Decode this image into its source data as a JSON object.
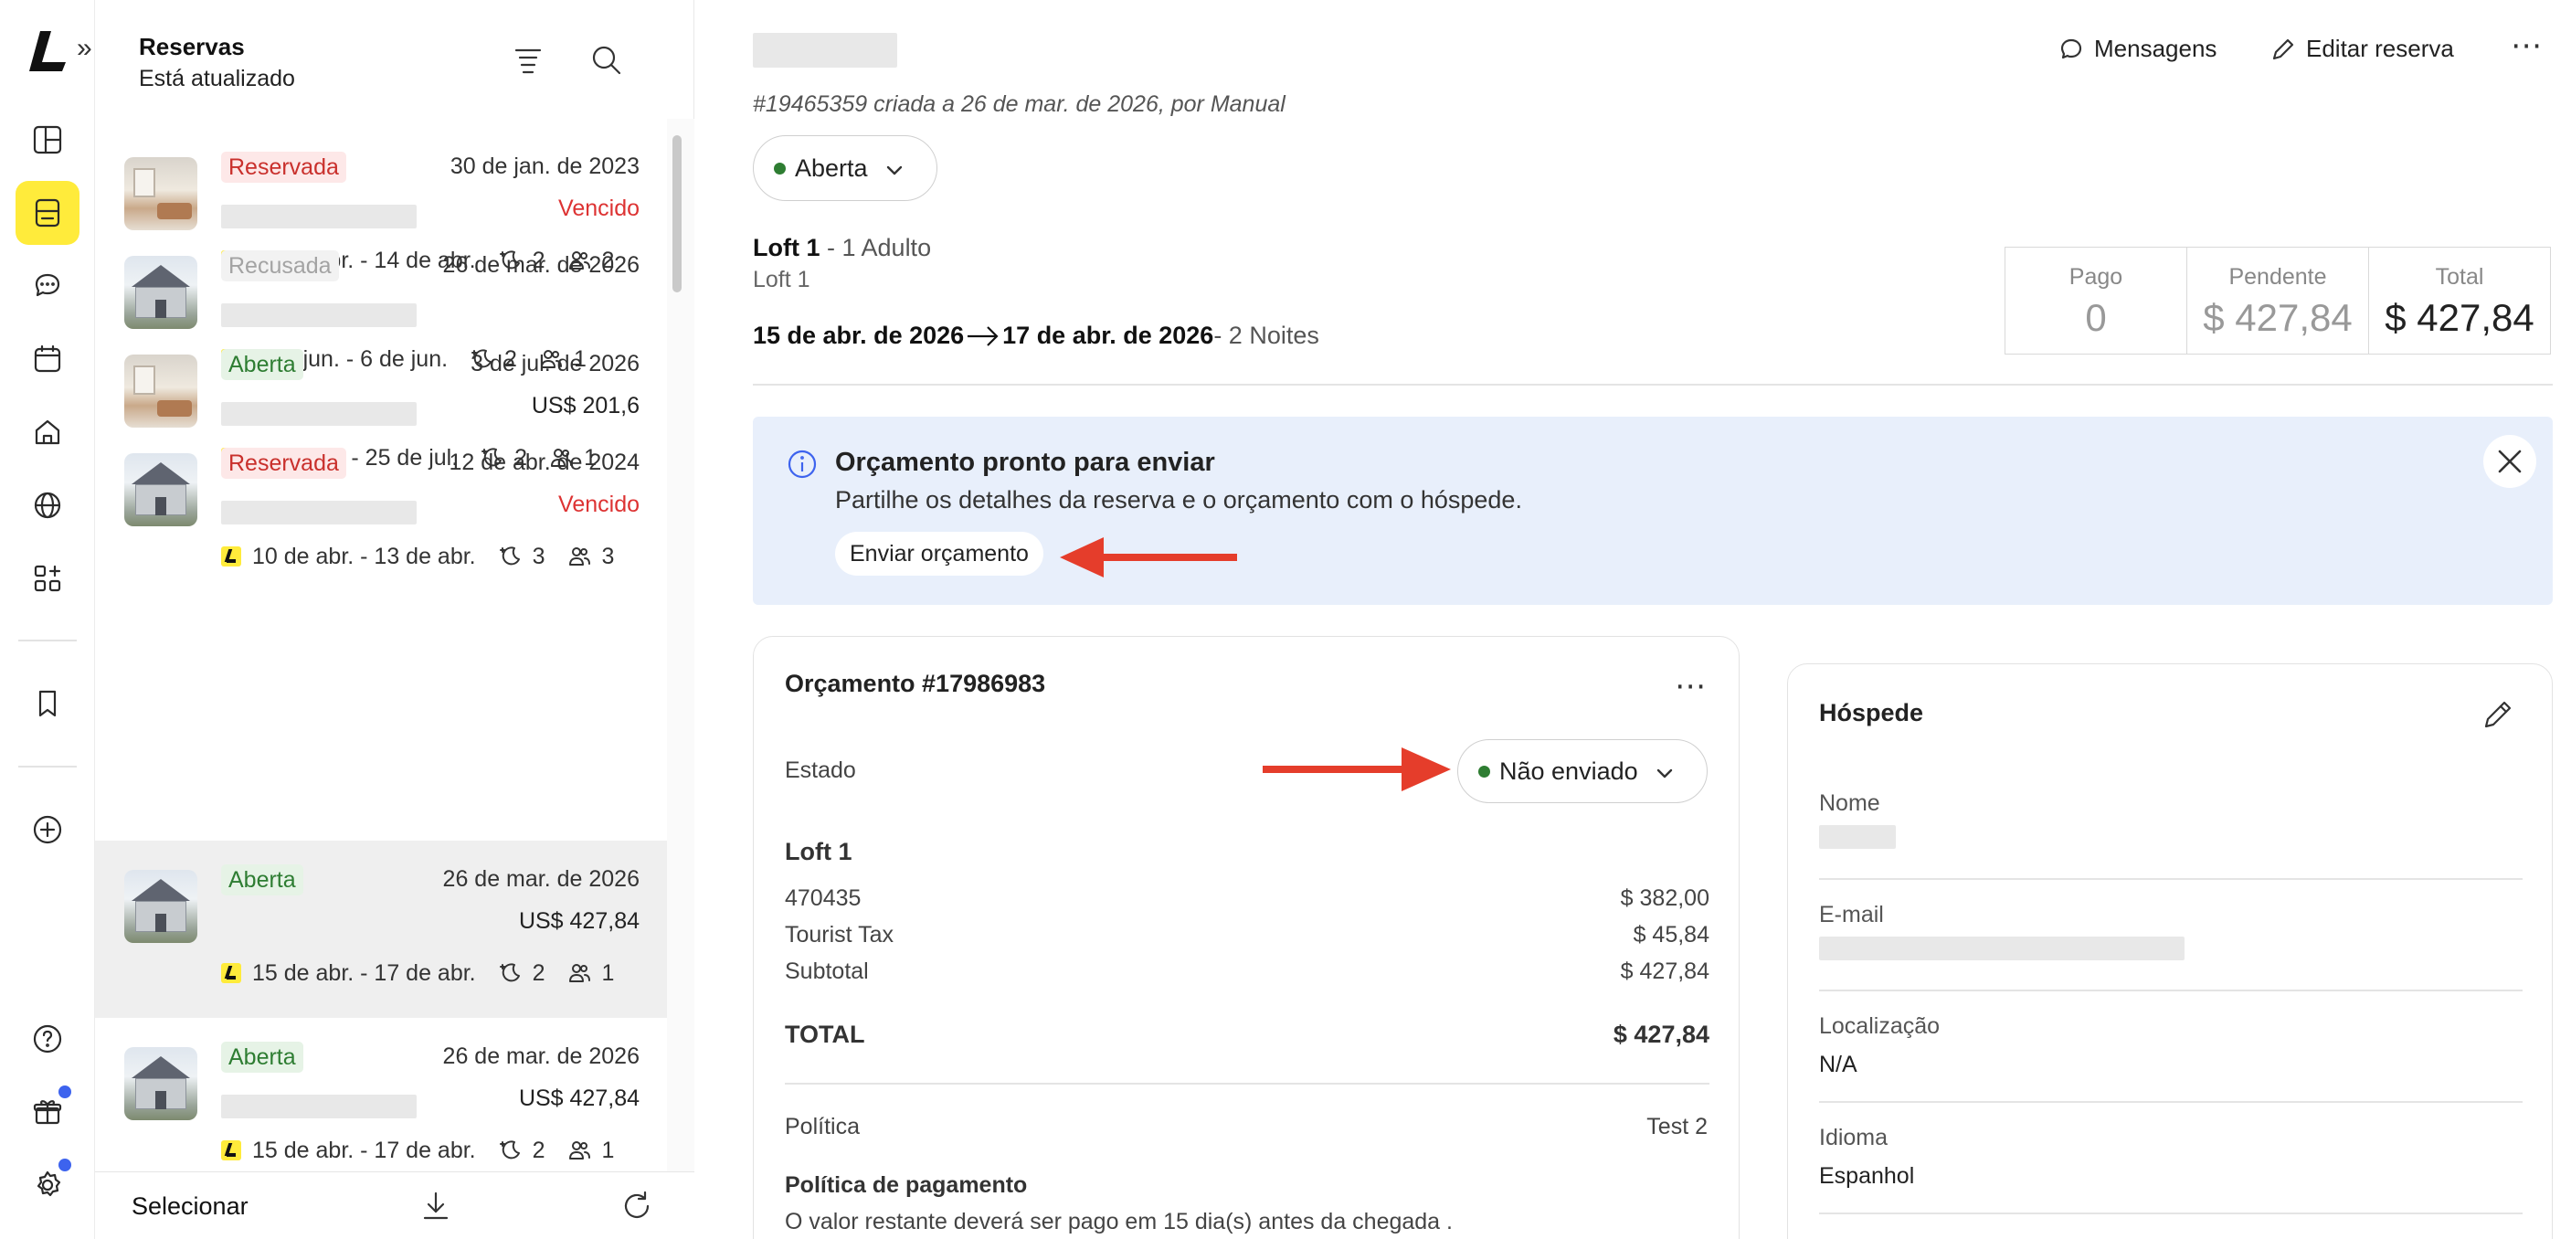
{
  "colors": {
    "accent_yellow": "#ffeb3b",
    "link_blue": "#3d63ee",
    "status_red": "#c9302c",
    "status_green": "#2e7d32",
    "arrow_red": "#e53d2b"
  },
  "list": {
    "title": "Reservas",
    "subtitle": "Está atualizado",
    "footer_select": "Selecionar",
    "items": [
      {
        "status": "Reservada",
        "date": "30 de jan. de 2023",
        "amount": "Vencido",
        "stay": "12 de abr. - 14 de abr.",
        "nights": "2",
        "guests": "2",
        "thumb": "room"
      },
      {
        "status": "Recusada",
        "date": "26 de mar. de 2026",
        "amount": "",
        "stay": "4 de jun. - 6 de jun.",
        "nights": "2",
        "guests": "1",
        "thumb": "house"
      },
      {
        "status": "Aberta",
        "date": "3 de jul. de 2026",
        "amount": "US$ 201,6",
        "stay": "23 de jul. - 25 de jul.",
        "nights": "2",
        "guests": "1",
        "thumb": "room"
      },
      {
        "status": "Reservada",
        "date": "12 de abr. de 2024",
        "amount": "Vencido",
        "stay": "10 de abr. - 13 de abr.",
        "nights": "3",
        "guests": "3",
        "thumb": "house"
      },
      {
        "status": "Aberta",
        "date": "26 de mar. de 2026",
        "amount": "US$ 427,84",
        "stay": "15 de abr. - 17 de abr.",
        "nights": "2",
        "guests": "1",
        "thumb": "house"
      },
      {
        "status": "Aberta",
        "date": "26 de mar. de 2026",
        "amount": "US$ 427,84",
        "stay": "15 de abr. - 17 de abr.",
        "nights": "2",
        "guests": "1",
        "thumb": "house"
      }
    ]
  },
  "header": {
    "actions": {
      "messages": "Mensagens",
      "edit": "Editar reserva",
      "more": "⋯"
    },
    "subtitle": "#19465359 criada a 26 de mar. de 2026, por Manual",
    "status": "Aberta"
  },
  "booking": {
    "room_name": "Loft 1",
    "room_guests": " - 1 Adulto",
    "room_sub": "Loft 1",
    "check_in": "15 de abr. de 2026",
    "check_out": "17 de abr. de 2026",
    "nights": " - 2 Noites"
  },
  "payments": {
    "paid_label": "Pago",
    "paid_value": "0",
    "pending_label": "Pendente",
    "pending_value": "$ 427,84",
    "total_label": "Total",
    "total_value": "$ 427,84"
  },
  "info": {
    "title": "Orçamento pronto para enviar",
    "desc": "Partilhe os detalhes da reserva e o orçamento com o hóspede.",
    "button": "Enviar orçamento"
  },
  "quote": {
    "title": "Orçamento #17986983",
    "more": "⋯",
    "estado_label": "Estado",
    "status": "Não enviado",
    "room": "Loft 1",
    "lines": [
      {
        "label": "470435",
        "value": "$ 382,00"
      },
      {
        "label": "Tourist Tax",
        "value": "$ 45,84"
      },
      {
        "label": "Subtotal",
        "value": "$ 427,84"
      }
    ],
    "total_label": "TOTAL",
    "total_value": "$ 427,84",
    "policy_label": "Política",
    "policy_value": "Test 2",
    "payment_policy_title": "Política de pagamento",
    "payment_policy_desc": "O valor restante deverá ser pago em 15 dia(s) antes da chegada ."
  },
  "guest": {
    "title": "Hóspede",
    "name_label": "Nome",
    "email_label": "E-mail",
    "location_label": "Localização",
    "location_value": "N/A",
    "language_label": "Idioma",
    "language_value": "Espanhol"
  }
}
